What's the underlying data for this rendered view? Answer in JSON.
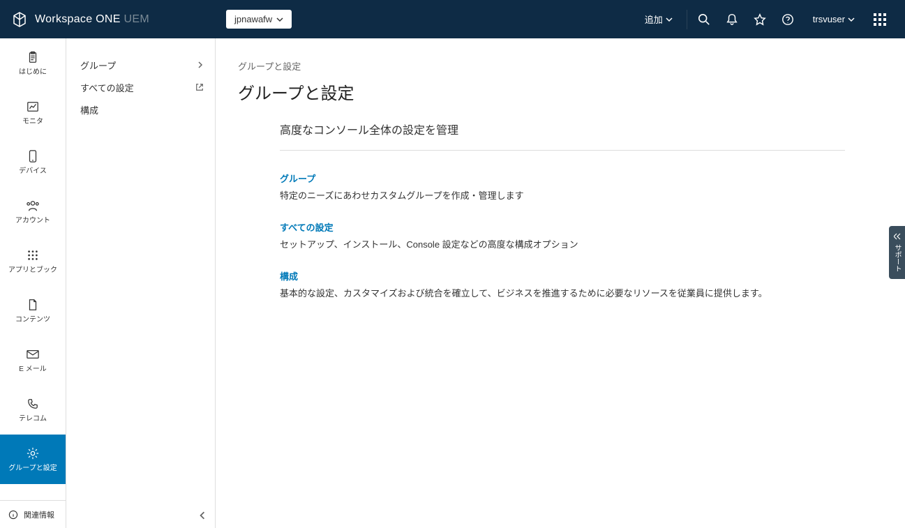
{
  "header": {
    "product_name": "Workspace ONE",
    "product_suffix": "UEM",
    "org_selector": "jpnawafw",
    "add_label": "追加",
    "user_name": "trsvuser"
  },
  "primary_nav": {
    "items": [
      {
        "label": "はじめに",
        "icon": "clipboard"
      },
      {
        "label": "モニタ",
        "icon": "chart"
      },
      {
        "label": "デバイス",
        "icon": "device"
      },
      {
        "label": "アカウント",
        "icon": "accounts"
      },
      {
        "label": "アプリとブック",
        "icon": "apps"
      },
      {
        "label": "コンテンツ",
        "icon": "document"
      },
      {
        "label": "E メール",
        "icon": "mail"
      },
      {
        "label": "テレコム",
        "icon": "phone"
      },
      {
        "label": "グループと設定",
        "icon": "gear",
        "active": true
      }
    ],
    "footer_label": "関連情報"
  },
  "secondary_nav": {
    "items": [
      {
        "label": "グループ",
        "right_icon": "chevron"
      },
      {
        "label": "すべての設定",
        "right_icon": "external"
      },
      {
        "label": "構成",
        "right_icon": ""
      }
    ]
  },
  "main": {
    "breadcrumb": "グループと設定",
    "title": "グループと設定",
    "subtitle": "高度なコンソール全体の設定を管理",
    "sections": [
      {
        "link": "グループ",
        "desc": "特定のニーズにあわせカスタムグループを作成・管理します"
      },
      {
        "link": "すべての設定",
        "desc": "セットアップ、インストール、Console 設定などの高度な構成オプション"
      },
      {
        "link": "構成",
        "desc": "基本的な設定、カスタマイズおよび統合を確立して、ビジネスを推進するために必要なリソースを従業員に提供します。"
      }
    ]
  },
  "side_tab": "サポート"
}
